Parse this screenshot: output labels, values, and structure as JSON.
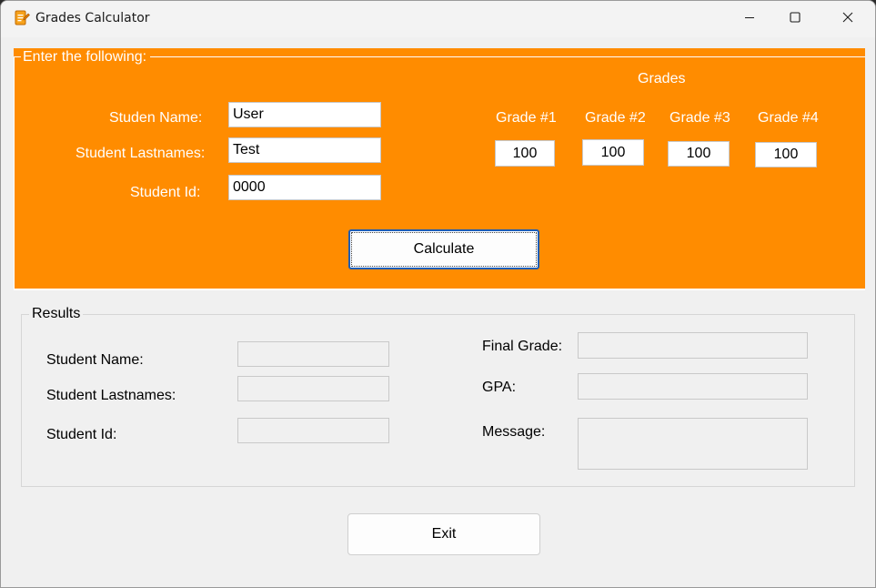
{
  "window": {
    "title": "Grades Calculator"
  },
  "input_panel": {
    "legend": "Enter the following:",
    "name_label": "Studen Name:",
    "name_value": "User",
    "lastnames_label": "Student Lastnames:",
    "lastnames_value": "Test",
    "id_label": "Student Id:",
    "id_value": "0000",
    "grades_heading": "Grades",
    "grades": [
      {
        "label": "Grade #1",
        "value": "100"
      },
      {
        "label": "Grade #2",
        "value": "100"
      },
      {
        "label": "Grade #3",
        "value": "100"
      },
      {
        "label": "Grade #4",
        "value": "100"
      }
    ],
    "calculate_label": "Calculate"
  },
  "results": {
    "legend": "Results",
    "name_label": "Student Name:",
    "lastnames_label": "Student Lastnames:",
    "id_label": "Student Id:",
    "final_grade_label": "Final Grade:",
    "gpa_label": "GPA:",
    "message_label": "Message:"
  },
  "exit_label": "Exit",
  "colors": {
    "panel_bg": "#ff8c00",
    "window_bg": "#f0f0f0",
    "focus_border": "#1e5db5"
  },
  "icons": {
    "app": "notepad-edit-icon",
    "minimize": "minimize-icon",
    "maximize": "maximize-icon",
    "close": "close-icon"
  }
}
